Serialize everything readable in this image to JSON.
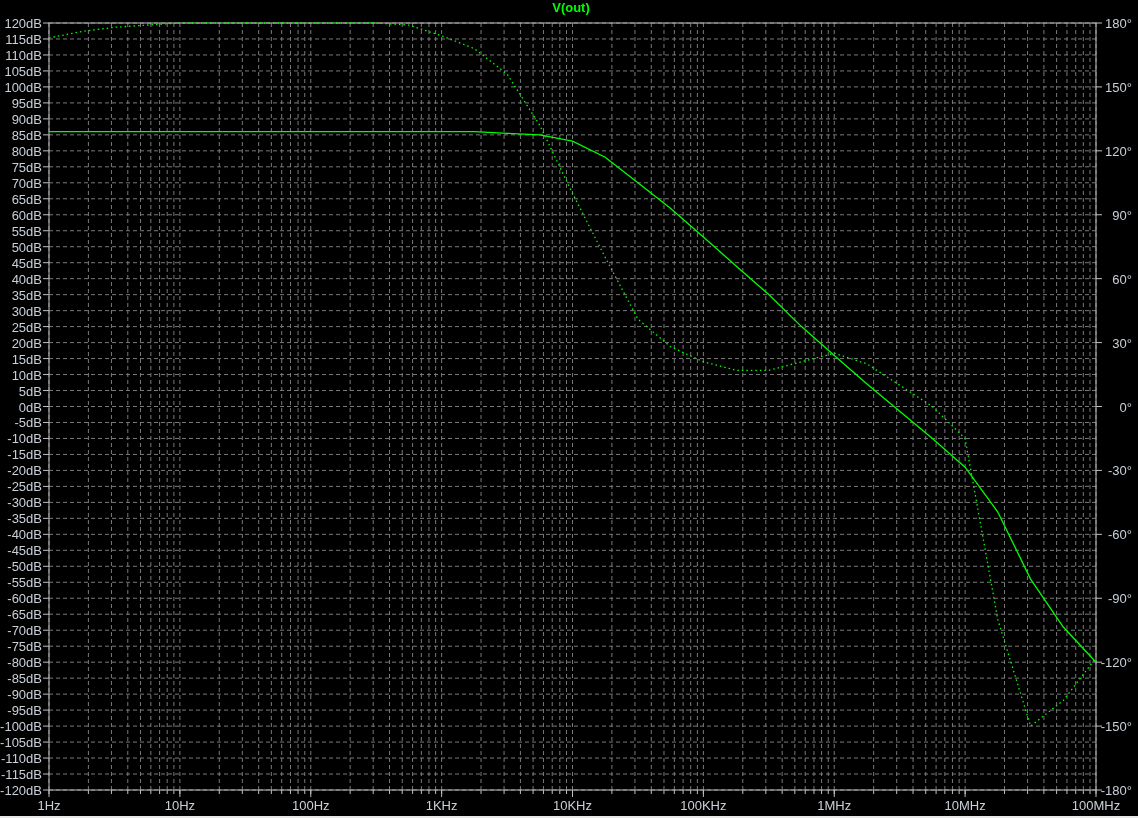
{
  "title": "V(out)",
  "chart_data": {
    "type": "line",
    "grid": true,
    "ylim": [
      -120,
      120
    ],
    "y2lim": [
      -180,
      180
    ],
    "categories": [
      "1Hz",
      null,
      null,
      null,
      "10Hz",
      null,
      null,
      null,
      "100Hz",
      null,
      null,
      null,
      "1KHz",
      null,
      null,
      null,
      "10KHz",
      null,
      null,
      null,
      "100KHz",
      null,
      null,
      null,
      "1MHz",
      null,
      null,
      null,
      "10MHz",
      null,
      null,
      null,
      "100MHz"
    ],
    "yticks": [
      {
        "value": 120,
        "label": "120dB"
      },
      {
        "value": 115,
        "label": "115dB"
      },
      {
        "value": 110,
        "label": "110dB"
      },
      {
        "value": 105,
        "label": "105dB"
      },
      {
        "value": 100,
        "label": "100dB"
      },
      {
        "value": 95,
        "label": "95dB"
      },
      {
        "value": 90,
        "label": "90dB"
      },
      {
        "value": 85,
        "label": "85dB"
      },
      {
        "value": 80,
        "label": "80dB"
      },
      {
        "value": 75,
        "label": "75dB"
      },
      {
        "value": 70,
        "label": "70dB"
      },
      {
        "value": 65,
        "label": "65dB"
      },
      {
        "value": 60,
        "label": "60dB"
      },
      {
        "value": 55,
        "label": "55dB"
      },
      {
        "value": 50,
        "label": "50dB"
      },
      {
        "value": 45,
        "label": "45dB"
      },
      {
        "value": 40,
        "label": "40dB"
      },
      {
        "value": 35,
        "label": "35dB"
      },
      {
        "value": 30,
        "label": "30dB"
      },
      {
        "value": 25,
        "label": "25dB"
      },
      {
        "value": 20,
        "label": "20dB"
      },
      {
        "value": 15,
        "label": "15dB"
      },
      {
        "value": 10,
        "label": "10dB"
      },
      {
        "value": 5,
        "label": "5dB"
      },
      {
        "value": 0,
        "label": "0dB"
      },
      {
        "value": -5,
        "label": "-5dB"
      },
      {
        "value": -10,
        "label": "-10dB"
      },
      {
        "value": -15,
        "label": "-15dB"
      },
      {
        "value": -20,
        "label": "-20dB"
      },
      {
        "value": -25,
        "label": "-25dB"
      },
      {
        "value": -30,
        "label": "-30dB"
      },
      {
        "value": -35,
        "label": "-35dB"
      },
      {
        "value": -40,
        "label": "-40dB"
      },
      {
        "value": -45,
        "label": "-45dB"
      },
      {
        "value": -50,
        "label": "-50dB"
      },
      {
        "value": -55,
        "label": "-55dB"
      },
      {
        "value": -60,
        "label": "-60dB"
      },
      {
        "value": -65,
        "label": "-65dB"
      },
      {
        "value": -70,
        "label": "-70dB"
      },
      {
        "value": -75,
        "label": "-75dB"
      },
      {
        "value": -80,
        "label": "-80dB"
      },
      {
        "value": -85,
        "label": "-85dB"
      },
      {
        "value": -90,
        "label": "-90dB"
      },
      {
        "value": -95,
        "label": "-95dB"
      },
      {
        "value": -100,
        "label": "-100dB"
      },
      {
        "value": -105,
        "label": "-105dB"
      },
      {
        "value": -110,
        "label": "-110dB"
      },
      {
        "value": -115,
        "label": "-115dB"
      },
      {
        "value": -120,
        "label": "-120dB"
      }
    ],
    "y2ticks": [
      {
        "value": 180,
        "label": "180°"
      },
      {
        "value": 150,
        "label": "150°"
      },
      {
        "value": 120,
        "label": "120°"
      },
      {
        "value": 90,
        "label": "90°"
      },
      {
        "value": 60,
        "label": "60°"
      },
      {
        "value": 30,
        "label": "30°"
      },
      {
        "value": 0,
        "label": "0°"
      },
      {
        "value": -30,
        "label": "-30°"
      },
      {
        "value": -60,
        "label": "-60°"
      },
      {
        "value": -90,
        "label": "-90°"
      },
      {
        "value": -120,
        "label": "-120°"
      },
      {
        "value": -150,
        "label": "-150°"
      },
      {
        "value": -180,
        "label": "-180°"
      }
    ],
    "series": [
      {
        "color": "#00ff00",
        "values": [
          86,
          86,
          86,
          86,
          86,
          86,
          86,
          86,
          86,
          86,
          86,
          86,
          86,
          86,
          85.5,
          85,
          83,
          78,
          70,
          62,
          53,
          44,
          35,
          25,
          16,
          7,
          -1.5,
          -10,
          -19,
          -33,
          -54,
          -69,
          -80
        ]
      },
      {
        "color": "#00ff00",
        "axis": "y2",
        "line_style": "dotted",
        "values": [
          173,
          176,
          178,
          179,
          180,
          180,
          180,
          180,
          180,
          180,
          180,
          179,
          174,
          168,
          156,
          132,
          100,
          70,
          41,
          28,
          21,
          17,
          17,
          21,
          25,
          20,
          10,
          0,
          -15,
          -100,
          -150,
          -138,
          -118
        ]
      }
    ]
  }
}
